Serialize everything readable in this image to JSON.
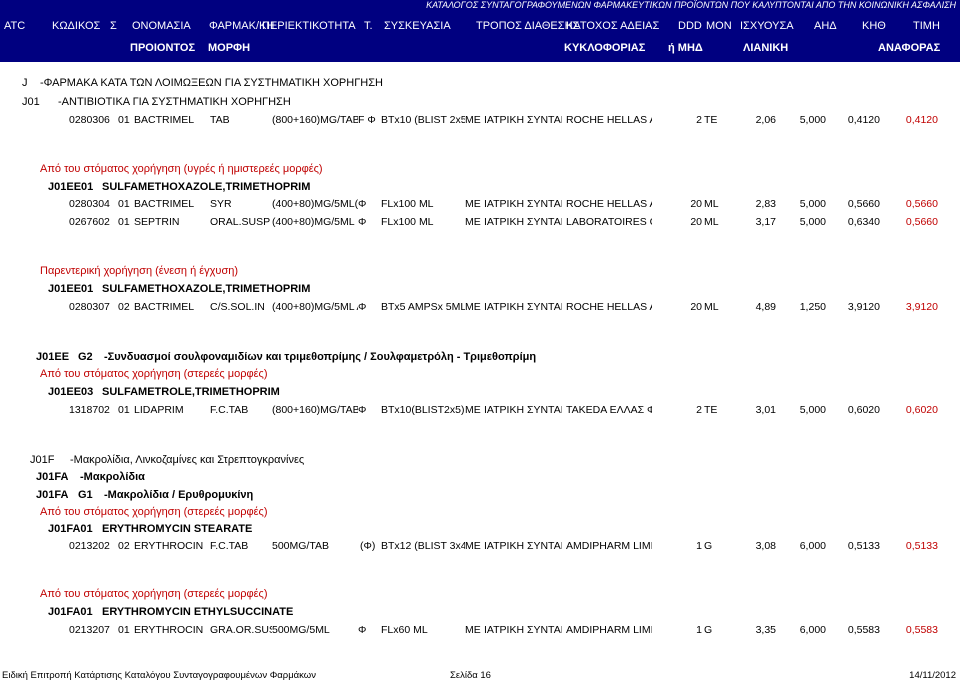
{
  "header": {
    "note": "ΚΑΤΑΛΟΓΟΣ ΣΥΝΤΑΓΟΓΡΑΦΟΥΜΕΝΩΝ ΦΑΡΜΑΚΕΥΤΙΚΩΝ ΠΡΟΪΟΝΤΩΝ ΠΟΥ ΚΑΛΥΠΤΟΝΤΑΙ ΑΠΟ ΤΗΝ ΚΟΙΝΩΝΙΚΗ ΑΣΦΑΛΙΣΗ",
    "row1": [
      "ATC",
      "ΚΩΔΙΚΟΣ",
      "Σ",
      "ΟΝΟΜΑΣΙΑ",
      "ΦΑΡΜΑΚ/ΚΗ",
      "ΠΕΡΙΕΚΤΙΚΟΤΗΤΑ",
      "Τ.",
      "ΣΥΣΚΕΥΑΣΙΑ",
      "ΤΡΟΠΟΣ ΔΙΑΘΕΣΗΣ",
      "ΚΑΤΟΧΟΣ ΑΔΕΙΑΣ",
      "DDD",
      "ΜΟΝ",
      "ΙΣΧΥΟΥΣΑ",
      "ΑΗΔ",
      "ΚΗΘ",
      "ΤΙΜΗ"
    ],
    "row2": [
      "ΠΡΟΙΟΝΤΟΣ",
      "ΜΟΡΦΗ",
      "ΚΥΚΛΟΦΟΡΙΑΣ",
      "ή ΜΗΔ",
      "ΛΙΑΝΙΚΗ",
      "ΑΝΑΦΟΡΑΣ"
    ]
  },
  "sections": {
    "j": {
      "code": "J",
      "label": "-ΦΑΡΜΑΚΑ ΚΑΤΑ ΤΩΝ ΛΟΙΜΩΞΕΩΝ ΓΙΑ ΣΥΣΤΗΜΑΤΙΚΗ ΧΟΡΗΓΗΣΗ"
    },
    "j01": {
      "code": "J01",
      "label": "-ΑΝΤΙΒΙΟΤΙΚΑ ΓΙΑ ΣΥΣΤΗΜΑΤΙΚΗ ΧΟΡΗΓΗΣΗ"
    },
    "oral1": "Από του στόματος χορήγηση (υγρές ή ημιστερεές μορφές)",
    "j01ee01a": {
      "code": "J01EE01",
      "label": "SULFAMETHOXAZOLE,TRIMETHOPRIM"
    },
    "parenteral": "Παρεντερική χορήγηση (ένεση ή έγχυση)",
    "j01ee01b": {
      "code": "J01EE01",
      "label": "SULFAMETHOXAZOLE,TRIMETHOPRIM"
    },
    "j01ee": {
      "code": "J01EE",
      "g": "G2",
      "label": "-Συνδυασμοί σουλφοναμιδίων και τριμεθοπρίμης / Σουλφαμετρόλη - Τριμεθοπρίμη"
    },
    "oral2": "Από του στόματος χορήγηση (στερεές μορφές)",
    "j01ee03": {
      "code": "J01EE03",
      "label": "SULFAMETROLE,TRIMETHOPRIM"
    },
    "j01f": {
      "code": "J01F",
      "label": "-Μακρολίδια, Λινκοζαμίνες και Στρεπτογκρανίνες"
    },
    "j01fa": {
      "code": "J01FA",
      "label": "-Μακρολίδια"
    },
    "j01fa_g1": {
      "code": "J01FA",
      "g": "G1",
      "label": "-Μακρολίδια / Ερυθρομυκίνη"
    },
    "oral3": "Από του στόματος χορήγηση (στερεές μορφές)",
    "j01fa01a": {
      "code": "J01FA01",
      "label": "ERYTHROMYCIN STEARATE"
    },
    "oral4": "Από του στόματος χορήγηση (στερεές μορφές)",
    "j01fa01b": {
      "code": "J01FA01",
      "label": "ERYTHROMYCIN ETHYLSUCCINATE"
    }
  },
  "rows": [
    {
      "code": "0280306",
      "s": "01",
      "name": "BACTRIMEL",
      "form": "TAB",
      "strength": "(800+160)MG/TAB",
      "t": "F Φ",
      "pack": "BTx10 (BLIST 2x5)",
      "ma": "ME",
      "route": "ΙΑΤΡΙΚΗ ΣΥΝΤΑΓ",
      "holder": "ROCHE HELLAS A.",
      "ddd": "2",
      "unit": "TE",
      "price": "2,06",
      "ahd": "5,000",
      "kth": "0,4120",
      "ref": "0,4120"
    },
    {
      "code": "0280304",
      "s": "01",
      "name": "BACTRIMEL",
      "form": "SYR",
      "strength": "(400+80)MG/5ML(FC",
      "t": "Φ",
      "pack": "FLx100 ML",
      "ma": "ME",
      "route": "ΙΑΤΡΙΚΗ ΣΥΝΤΑΓ",
      "holder": "ROCHE HELLAS A.",
      "ddd": "20",
      "unit": "ML",
      "price": "2,83",
      "ahd": "5,000",
      "kth": "0,5660",
      "ref": "0,5660"
    },
    {
      "code": "0267602",
      "s": "01",
      "name": "SEPTRIN",
      "form": "ORAL.SUSP",
      "strength": "(400+80)MG/5ML",
      "t": "Φ",
      "pack": "FLx100 ML",
      "ma": "ME",
      "route": "ΙΑΤΡΙΚΗ ΣΥΝΤΑΓ",
      "holder": "LABORATOIRES G",
      "ddd": "20",
      "unit": "ML",
      "price": "3,17",
      "ahd": "5,000",
      "kth": "0,6340",
      "ref": "0,5660"
    },
    {
      "code": "0280307",
      "s": "02",
      "name": "BACTRIMEL",
      "form": "C/S.SOL.IN",
      "strength": "(400+80)MG/5ML AM",
      "t": "Φ",
      "pack": "BTx5 AMPSx 5ML",
      "ma": "ME",
      "route": "ΙΑΤΡΙΚΗ ΣΥΝΤΑΓ",
      "holder": "ROCHE HELLAS A.",
      "ddd": "20",
      "unit": "ML",
      "price": "4,89",
      "ahd": "1,250",
      "kth": "3,9120",
      "ref": "3,9120"
    },
    {
      "code": "1318702",
      "s": "01",
      "name": "LIDAPRIM",
      "form": "F.C.TAB",
      "strength": "(800+160)MG/TAB",
      "t": "Φ",
      "pack": "BTx10(BLIST2x5)",
      "ma": "ME",
      "route": "ΙΑΤΡΙΚΗ ΣΥΝΤΑΓ",
      "holder": "TAKEDA ΕΛΛΑΣ ΦΑ",
      "ddd": "2",
      "unit": "TE",
      "price": "3,01",
      "ahd": "5,000",
      "kth": "0,6020",
      "ref": "0,6020"
    },
    {
      "code": "0213202",
      "s": "02",
      "name": "ERYTHROCIN",
      "form": "F.C.TAB",
      "strength": "500MG/TAB",
      "t": "(Φ)",
      "pack": "BTx12 (BLIST 3x4)",
      "ma": "ME",
      "route": "ΙΑΤΡΙΚΗ ΣΥΝΤΑΓ",
      "holder": "AMDIPHARM LIMIT",
      "ddd": "1",
      "unit": "G",
      "price": "3,08",
      "ahd": "6,000",
      "kth": "0,5133",
      "ref": "0,5133"
    },
    {
      "code": "0213207",
      "s": "01",
      "name": "ERYTHROCIN",
      "form": "GRA.OR.SUSP",
      "strength": "500MG/5ML",
      "t": "Φ",
      "pack": "FLx60 ML",
      "ma": "ME",
      "route": "ΙΑΤΡΙΚΗ ΣΥΝΤΑΓ",
      "holder": "AMDIPHARM LIMIT",
      "ddd": "1",
      "unit": "G",
      "price": "3,35",
      "ahd": "6,000",
      "kth": "0,5583",
      "ref": "0,5583"
    }
  ],
  "footer": {
    "left": "Ειδική Επιτροπή Κατάρτισης Καταλόγου Συνταγογραφουμένων Φαρμάκων",
    "center": "Σελίδα 16",
    "right": "14/11/2012"
  }
}
